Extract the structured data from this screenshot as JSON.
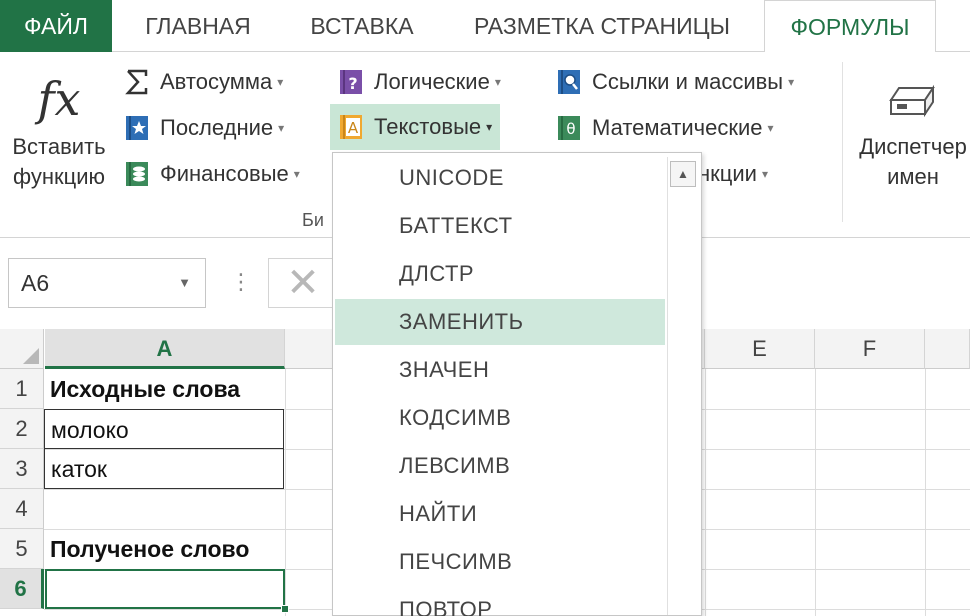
{
  "tabs": {
    "file": "ФАЙЛ",
    "home": "ГЛАВНАЯ",
    "insert": "ВСТАВКА",
    "layout": "РАЗМЕТКА СТРАНИЦЫ",
    "formulas": "ФОРМУЛЫ"
  },
  "ribbon": {
    "insert_function_line1": "Вставить",
    "insert_function_line2": "функцию",
    "fx": "fx",
    "autosum": "Автосумма",
    "recent": "Последние",
    "financial": "Финансовые",
    "logical": "Логические",
    "text": "Текстовые",
    "lookup": "Ссылки и массивы",
    "math": "Математические",
    "more_partial": "нкции",
    "name_manager_line1": "Диспетчер",
    "name_manager_line2": "имен",
    "group_label_partial": "Би"
  },
  "formula_bar": {
    "name_box": "A6",
    "dots": "⋮",
    "cancel": "✕"
  },
  "sheet": {
    "columns": [
      "A",
      "E",
      "F"
    ],
    "rows": [
      "1",
      "2",
      "3",
      "4",
      "5",
      "6"
    ],
    "cells": {
      "A1": "Исходные слова",
      "A2": "молоко",
      "A3": "каток",
      "A5": "Полученое слово"
    }
  },
  "dropdown": {
    "items": [
      "UNICODE",
      "БАТТЕКСТ",
      "ДЛСТР",
      "ЗАМЕНИТЬ",
      "ЗНАЧЕН",
      "КОДСИМВ",
      "ЛЕВСИМВ",
      "НАЙТИ",
      "ПЕЧСИМВ",
      "ПОВТОР"
    ],
    "highlighted": "ЗАМЕНИТЬ"
  },
  "colors": {
    "accent": "#217346",
    "highlight": "#cfe8dc"
  }
}
